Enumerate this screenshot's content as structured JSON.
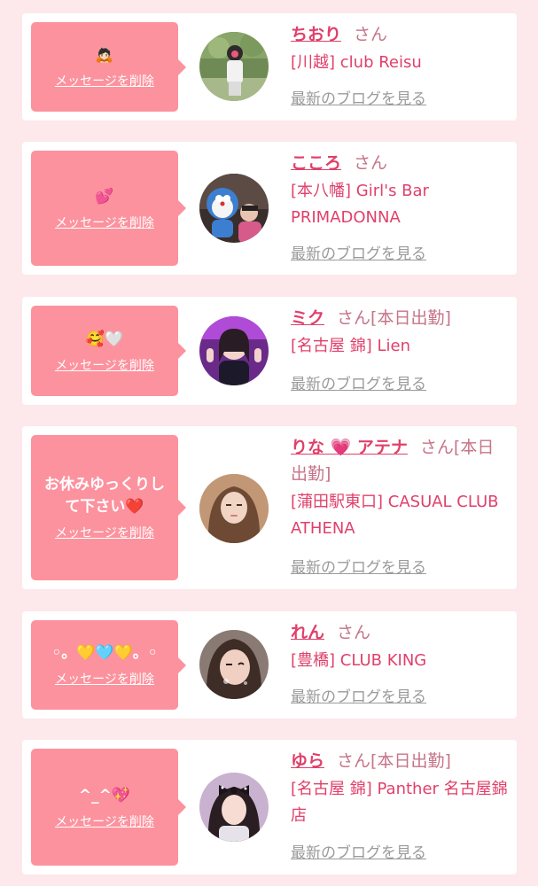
{
  "colors": {
    "background": "#fde8ec",
    "card": "#ffffff",
    "bubble": "#fc929e",
    "accent": "#e0406a",
    "muted": "#9a9a9a"
  },
  "delete_label": "メッセージを削除",
  "blog_label": "最新のブログを見る",
  "honorific": "さん",
  "items": [
    {
      "message": "🙇🏻",
      "name": "ちおり",
      "status": "",
      "shop": "[川越] club Reisu",
      "avatar_icon": "photo-golf-player"
    },
    {
      "message": "💕",
      "name": "こころ",
      "status": "",
      "shop": "[本八幡] Girl's Bar PRIMADONNA",
      "avatar_icon": "photo-doraemon-plush"
    },
    {
      "message": "🥰🤍",
      "name": "ミク",
      "status": "[本日出勤]",
      "shop": "[名古屋 錦] Lien",
      "avatar_icon": "photo-peace-sign-girl"
    },
    {
      "message": "お休みゆっくりして下さい❤️",
      "name": "りな 💗 アテナ",
      "status": "[本日出勤]",
      "shop": "[蒲田駅東口] CASUAL CLUB ATHENA",
      "avatar_icon": "photo-portrait-girl"
    },
    {
      "message": "◦。💛🩵💛。◦",
      "name": "れん",
      "status": "",
      "shop": "[豊橋] CLUB KING",
      "avatar_icon": "photo-selfie-girl"
    },
    {
      "message": "^_^💖",
      "name": "ゆら",
      "status": "[本日出勤]",
      "shop": "[名古屋 錦] Panther 名古屋錦店",
      "avatar_icon": "photo-bow-girl"
    }
  ]
}
